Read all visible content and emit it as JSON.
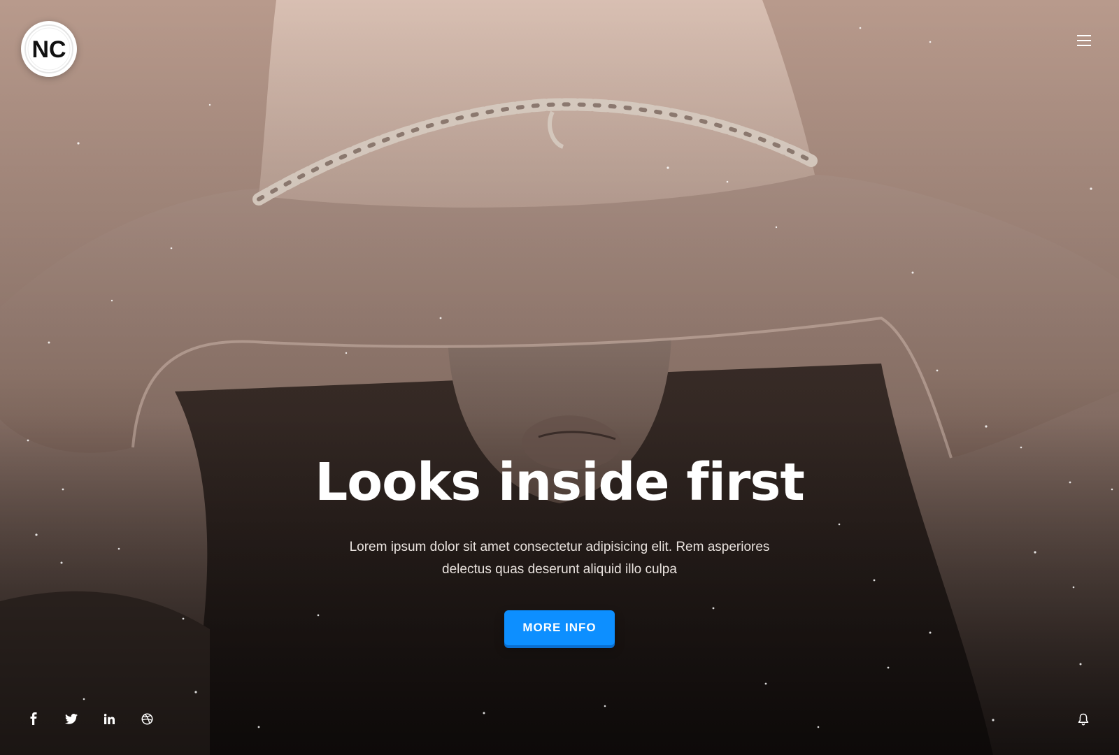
{
  "brand": {
    "logo_text": "NC",
    "logo_icon": "nc-monogram-logo"
  },
  "header": {
    "menu_icon": "hamburger-menu-icon"
  },
  "hero": {
    "title": "Looks inside first",
    "subtitle": "Lorem ipsum dolor sit amet consectetur adipisicing elit. Rem asperiores delectus quas deserunt aliquid illo culpa",
    "cta_label": "MORE INFO",
    "background_image": "woman wearing wide-brim felt hat with gold chain band, sepia tone"
  },
  "footer": {
    "social_icons": [
      "facebook-icon",
      "twitter-icon",
      "linkedin-icon",
      "dribbble-icon"
    ],
    "notification_icon": "bell-icon"
  },
  "colors": {
    "accent": "#0d8fff",
    "text": "#ffffff",
    "overlay_tone": "#b49486"
  }
}
